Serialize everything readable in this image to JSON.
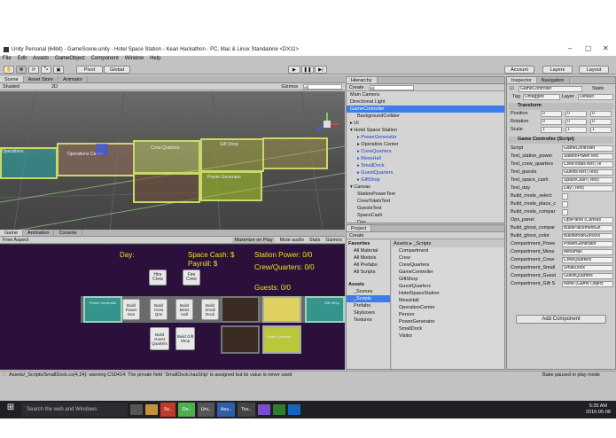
{
  "window": {
    "title": "Unity Personal (64bit) - GameScene.unity - Hotel Space Station - Kean Hackathon - PC, Mac & Linux Standalone <DX11>"
  },
  "menu": [
    "File",
    "Edit",
    "Assets",
    "GameObject",
    "Component",
    "Window",
    "Help"
  ],
  "toolbar": {
    "pivot": "Pivot",
    "global": "Global",
    "account": "Account",
    "layers": "Layers",
    "layout": "Layout"
  },
  "scene": {
    "tabs": [
      "Scene",
      "Asset Store",
      "Animator"
    ],
    "shaded": "Shaded",
    "mode2d": "2D",
    "gizmos": "Gizmos",
    "search": "All",
    "labels": {
      "a": "Operations",
      "b": "Operations Center",
      "c": "Crew Quarters",
      "d": "Gift Shop",
      "e": "Power Generator",
      "f": "Guest Quarters"
    }
  },
  "game": {
    "tabs": [
      "Game",
      "Animation",
      "Console"
    ],
    "aspect": "Free Aspect",
    "maximize": "Maximize on Play",
    "mute": "Mute audio",
    "stats": "Stats",
    "gizmos": "Gizmos",
    "day": "Day:",
    "space_cash": "Space Cash: $",
    "payroll": "Payroll: $",
    "station_power": "Station Power: 0/0",
    "crew_quarters": "Crew/Quarters: 0/0",
    "guests": "Guests: 0/0",
    "hire_crew": "Hire Crew",
    "fire_crew": "Fire Crew",
    "build_power": "Build Power Gen",
    "build_crew": "Build Crew Qrts",
    "build_mess": "Build Mess Hall",
    "build_small": "Build Small Dock",
    "build_guest": "Build Guest Quarters",
    "build_gift": "Build Gift Shop",
    "room_power": "Power Generator",
    "room_gift": "Gift Shop",
    "room_guest": "Guest Quarters"
  },
  "hierarchy": {
    "tab": "Hierarchy",
    "create": "Create",
    "search": "All",
    "items": [
      {
        "t": "Main Camera",
        "d": 0
      },
      {
        "t": "Directional Light",
        "d": 0
      },
      {
        "t": "GameController",
        "d": 0,
        "sel": true
      },
      {
        "t": "BackgroundCollider",
        "d": 1
      },
      {
        "t": "▸ UI",
        "d": 0
      },
      {
        "t": "▾ Hotel Space Station",
        "d": 0
      },
      {
        "t": "▸ PowerGenerator",
        "d": 1,
        "b": true
      },
      {
        "t": "▸ Operation Center",
        "d": 1
      },
      {
        "t": "▸ CrewQuarters",
        "d": 1,
        "b": true
      },
      {
        "t": "▸ MessHall",
        "d": 1,
        "b": true
      },
      {
        "t": "▸ SmallDock",
        "d": 1,
        "b": true
      },
      {
        "t": "▸ GuestQuarters",
        "d": 1,
        "b": true
      },
      {
        "t": "▸ GiftShop",
        "d": 1,
        "b": true
      },
      {
        "t": "▾ Canvas",
        "d": 0
      },
      {
        "t": "StationPowerText",
        "d": 1
      },
      {
        "t": "CrewTotalsText",
        "d": 1
      },
      {
        "t": "GuestsText",
        "d": 1
      },
      {
        "t": "SpaceCash",
        "d": 1
      },
      {
        "t": "Day",
        "d": 1
      },
      {
        "t": "▾ OpsPanel",
        "d": 0
      }
    ]
  },
  "project": {
    "tab": "Project",
    "create": "Create",
    "favorites": "Favorites",
    "fav_items": [
      "All Material",
      "All Models",
      "All Prefabs",
      "All Scripts"
    ],
    "assets": "Assets",
    "asset_items": [
      "_Scenes",
      "_Scripts",
      "Prefabs",
      "Skyboxes",
      "Textures"
    ],
    "path": "Assets ▸ _Scripts",
    "files": [
      "Compartment",
      "Crew",
      "CrewQuarters",
      "GameController",
      "GiftShop",
      "GuestQuarters",
      "HotelSpaceStation",
      "MessHall",
      "OperationCenter",
      "Person",
      "PowerGenerator",
      "SmallDock",
      "Visitor"
    ]
  },
  "inspector": {
    "tabs": [
      "Inspector",
      "Navigation"
    ],
    "object": "GameController",
    "static": "Static",
    "tag": "Untagged",
    "layer": "Default",
    "transform": "Transform",
    "position": {
      "x": "0",
      "y": "0",
      "z": "0"
    },
    "rotation": {
      "x": "0",
      "y": "0",
      "z": "0"
    },
    "scale": {
      "x": "1",
      "y": "1",
      "z": "1"
    },
    "script_title": "Game Controller (Script)",
    "fields": [
      [
        "Script",
        "GameController"
      ],
      [
        "Text_station_power",
        "StationPowerText"
      ],
      [
        "Text_crew_quarters",
        "CrewTotalsText (Te"
      ],
      [
        "Text_guests",
        "GuestsText (Text)"
      ],
      [
        "Text_space_cash",
        "SpaceCash (Text)"
      ],
      [
        "Text_day",
        "Day (Text)"
      ],
      [
        "Build_mode_select",
        ""
      ],
      [
        "Build_mode_place_c",
        ""
      ],
      [
        "Build_mode_compar",
        ""
      ],
      [
        "Ops_panel",
        "OpsPanel (Canvas"
      ],
      [
        "Build_ghost_compar",
        "BuildPlacementGh"
      ],
      [
        "Build_ghost_color",
        "BuildModeGhostVi"
      ],
      [
        "Compartment_Powe",
        "PowerGenerator"
      ],
      [
        "Compartment_Mess",
        "MessHall"
      ],
      [
        "Compartment_Crew",
        "CrewQuarters"
      ],
      [
        "Compartment_Small",
        "SmallDock"
      ],
      [
        "Compartment_Guest",
        "GuestQuarters"
      ],
      [
        "Compartment_Gift S",
        "None (Game Object"
      ]
    ],
    "add_component": "Add Component"
  },
  "status": {
    "warning": "Assets/_Scripts/SmallDock.cs(4,24): warning CS0414: The private field `SmallDock.hasShip' is assigned but its value is never used",
    "bake": "Bake paused in play mode"
  },
  "taskbar": {
    "search": "Search the web and Windows",
    "apps": [
      "Sc..",
      "De..",
      "Uni..",
      "Ass..",
      "Tex.."
    ],
    "time": "5:35 AM",
    "date": "2016-05-08"
  }
}
